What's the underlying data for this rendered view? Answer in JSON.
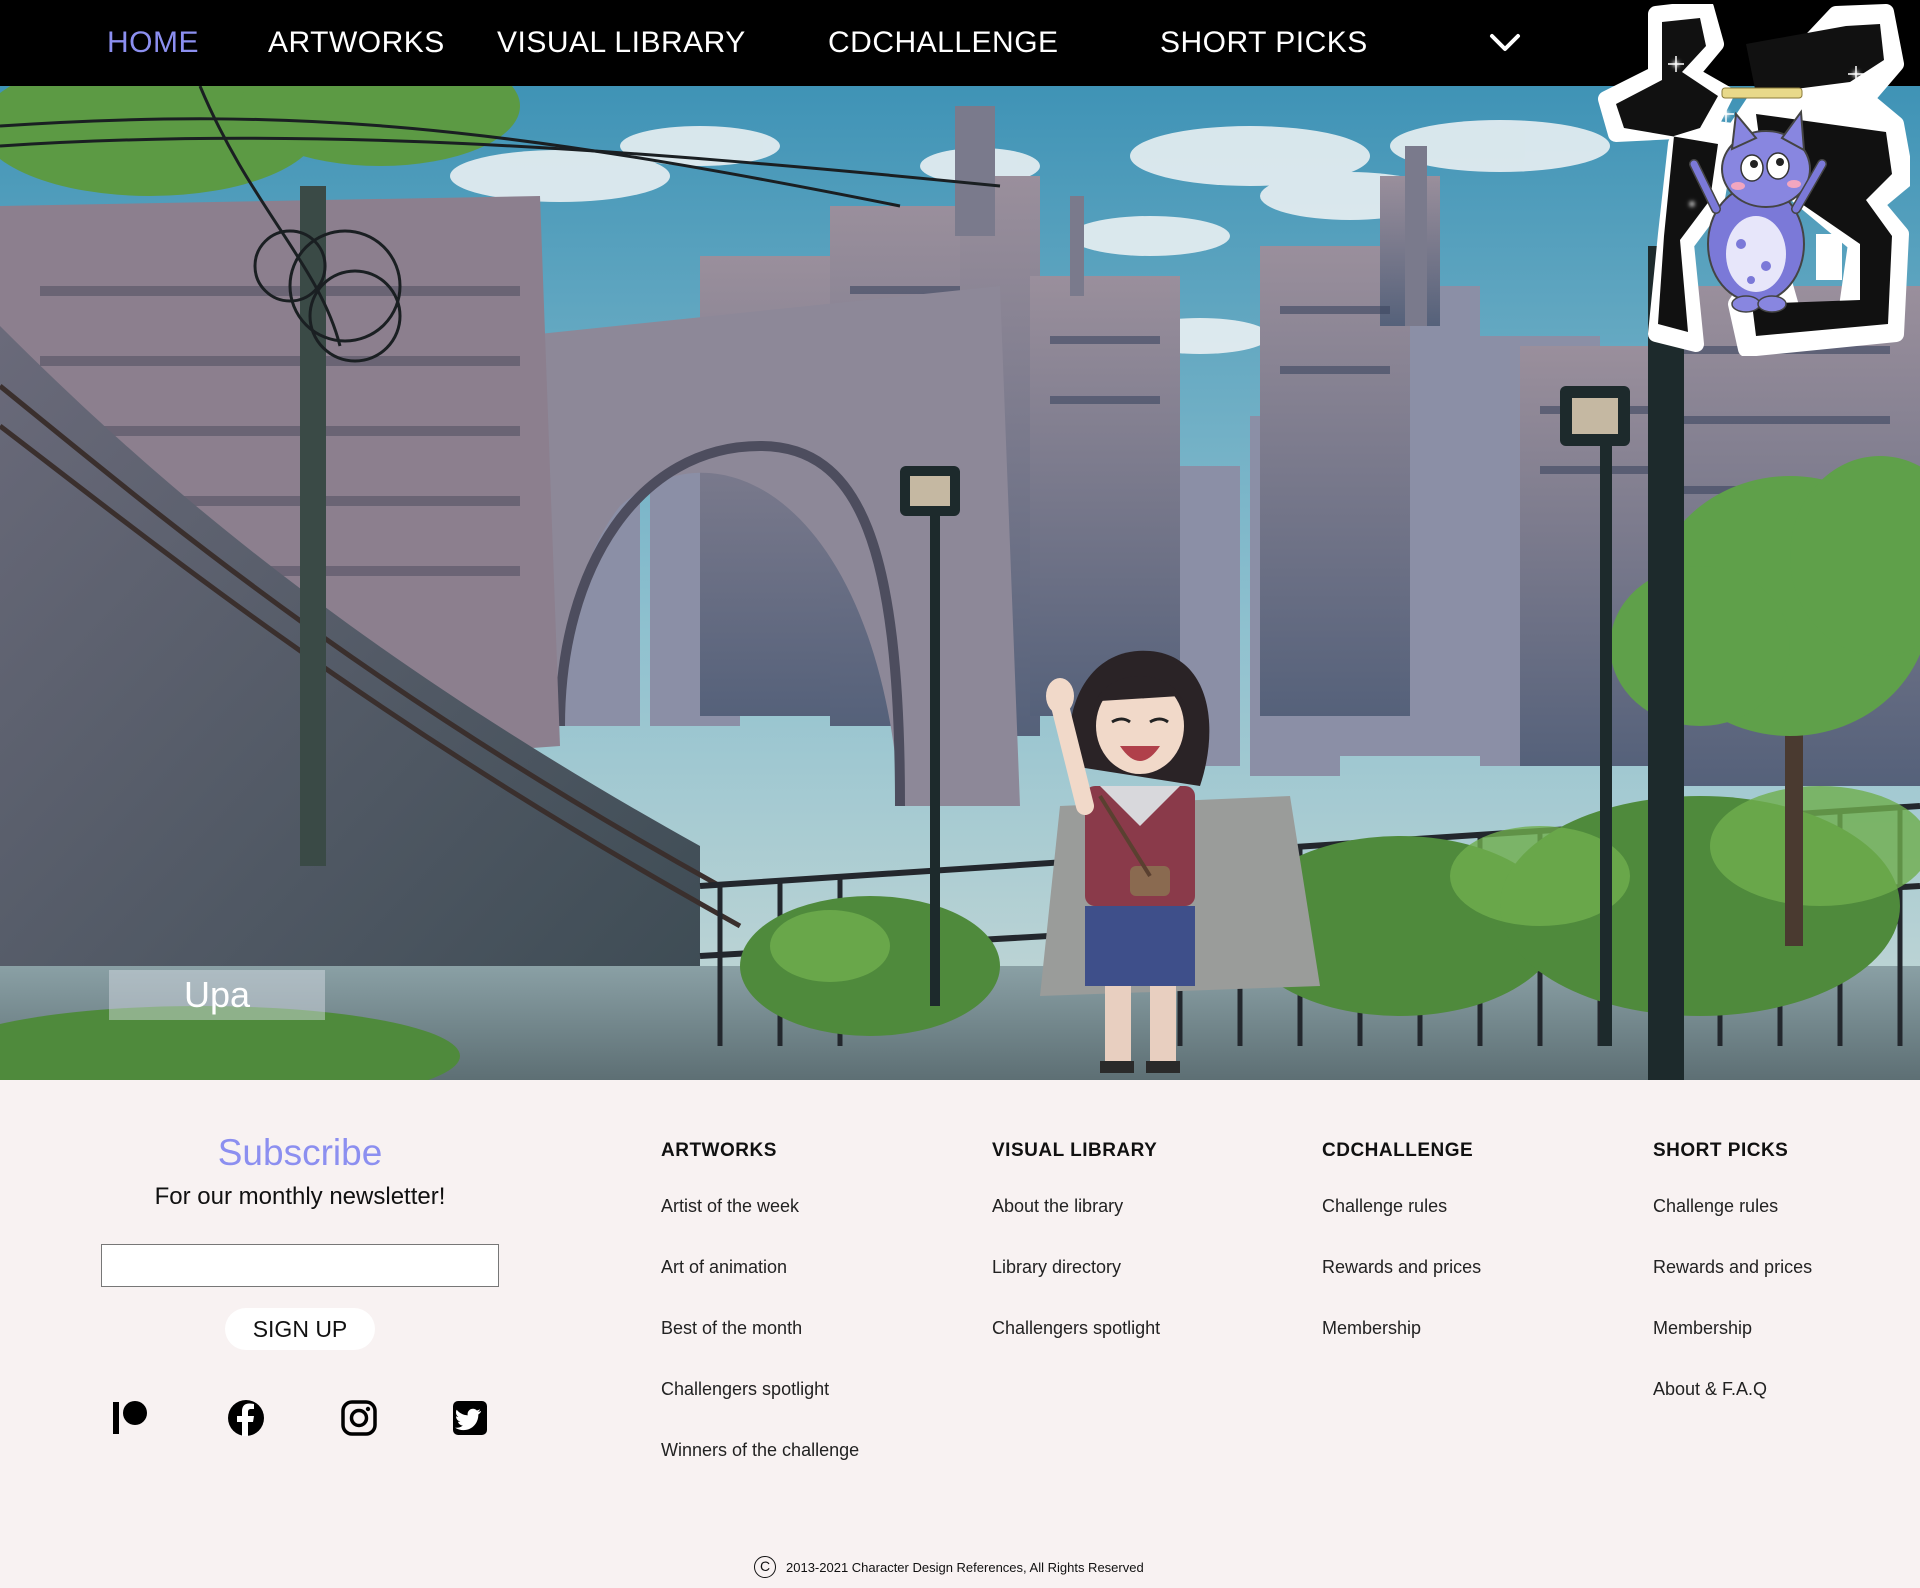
{
  "nav": {
    "items": [
      {
        "label": "HOME",
        "active": true
      },
      {
        "label": "ARTWORKS"
      },
      {
        "label": "VISUAL LIBRARY"
      },
      {
        "label": "CDCHALLENGE"
      },
      {
        "label": "SHORT PICKS"
      }
    ],
    "more_icon": "chevron-down-icon"
  },
  "logo": {
    "icon": "fuku-kanji-cat-mascot"
  },
  "hero": {
    "caption": "Upa",
    "image": "anime girl waving in front of a towering hillside city with an arch bridge"
  },
  "subscribe": {
    "title": "Subscribe",
    "subtitle": "For our monthly newsletter!",
    "input_value": "",
    "button": "SIGN UP"
  },
  "social": [
    "patreon-icon",
    "facebook-icon",
    "instagram-icon",
    "twitter-icon"
  ],
  "footer": {
    "columns": [
      {
        "title": "ARTWORKS",
        "links": [
          "Artist of the week",
          "Art of animation",
          "Best of the month",
          "Challengers spotlight",
          "Winners of the challenge"
        ]
      },
      {
        "title": "VISUAL LIBRARY",
        "links": [
          "About the library",
          "Library directory",
          "Challengers spotlight"
        ]
      },
      {
        "title": "CDCHALLENGE",
        "links": [
          "Challenge rules",
          "Rewards and prices",
          "Membership"
        ]
      },
      {
        "title": "SHORT PICKS",
        "links": [
          "Challenge rules",
          "Rewards and prices",
          "Membership",
          "About & F.A.Q"
        ]
      }
    ],
    "copyright": "2013-2021 Character Design References, All Rights Reserved"
  },
  "colors": {
    "accent": "#8c8ff0",
    "nav_bg": "#000000",
    "footer_bg": "#f8f2f2"
  }
}
